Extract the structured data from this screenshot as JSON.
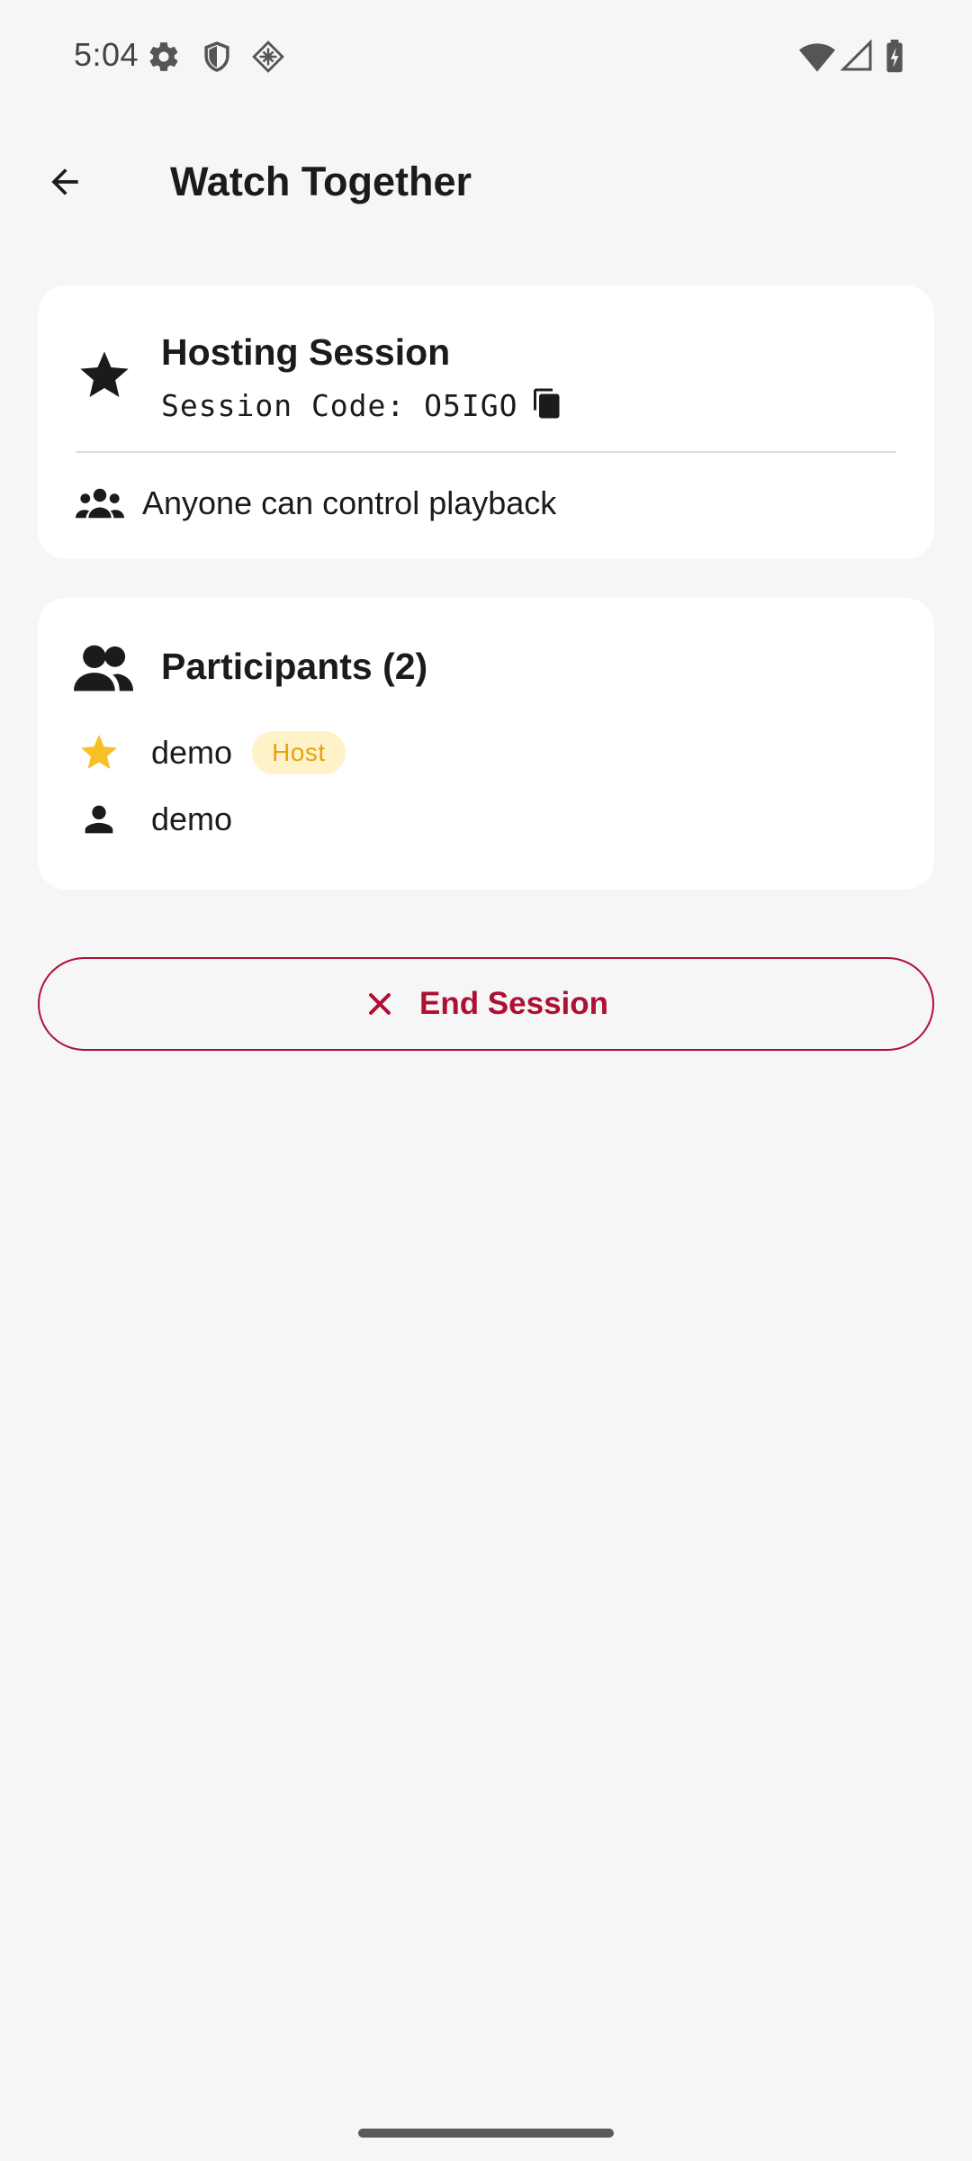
{
  "status_bar": {
    "time": "5:04",
    "icons": [
      "settings-gear-icon",
      "shield-icon",
      "location-diamond-icon",
      "wifi-icon",
      "cell-signal-icon",
      "battery-charging-icon"
    ]
  },
  "app_bar": {
    "title": "Watch Together",
    "back_icon": "arrow-left-icon"
  },
  "hosting_card": {
    "title": "Hosting Session",
    "session_code": "Session Code: O5IGO",
    "copy_icon": "copy-icon",
    "control_text": "Anyone can control playback",
    "control_icon": "group-icon"
  },
  "participants_card": {
    "title": "Participants (2)",
    "participants": [
      {
        "name": "demo",
        "badge": "Host",
        "icon": "star-icon"
      },
      {
        "name": "demo",
        "icon": "person-icon"
      }
    ]
  },
  "end_button": {
    "label": "End Session",
    "icon": "close-icon"
  },
  "colors": {
    "background": "#f6f6f6",
    "card": "#ffffff",
    "danger": "#ad1034",
    "host_badge_bg": "#fff2c9",
    "host_badge_text": "#e2a411",
    "star_gold": "#f6c026"
  }
}
